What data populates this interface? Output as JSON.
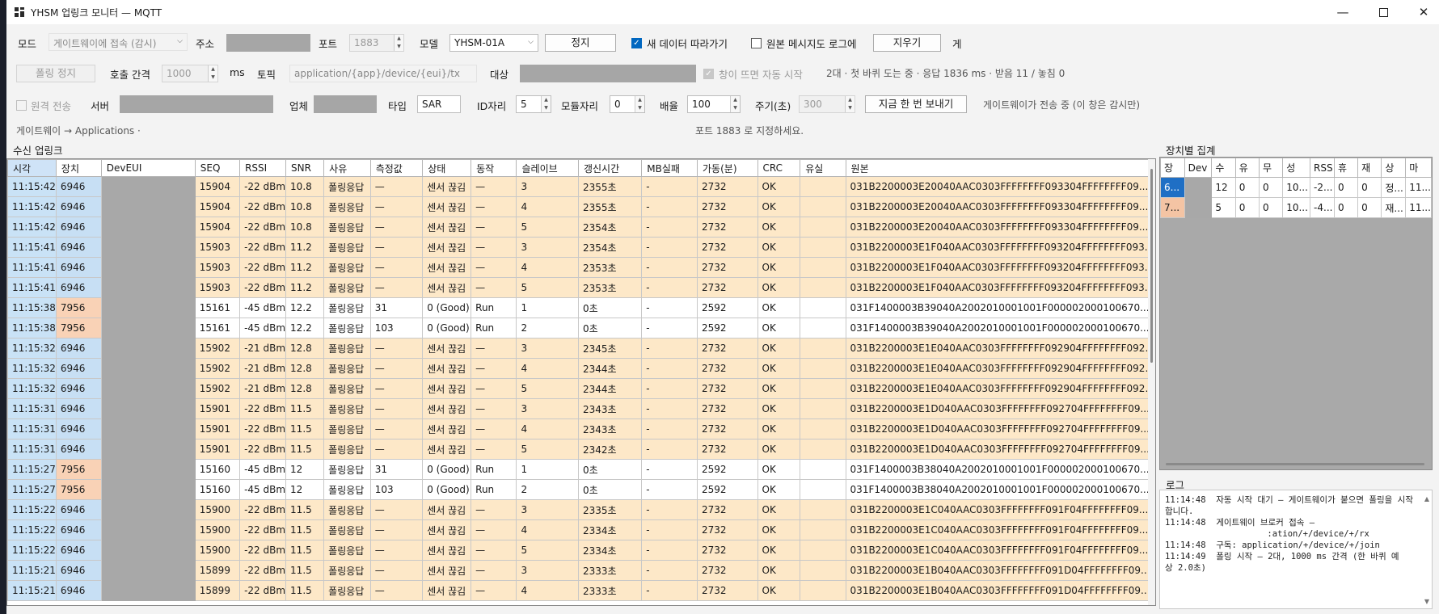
{
  "window": {
    "title": "YHSM 업링크 모니터 — MQTT"
  },
  "toolbar1": {
    "mode_label": "모드",
    "mode_value": "게이트웨이에 접속 (감시)",
    "addr_label": "주소",
    "port_label": "포트",
    "port_value": "1883",
    "model_label": "모델",
    "model_value": "YHSM-01A",
    "stop_button": "정지",
    "follow_label": "새 데이터 따라가기",
    "rawlog_label": "원본 메시지도 로그에",
    "clear_button": "지우기",
    "overflow_label": "게"
  },
  "toolbar2": {
    "poll_stop_button": "폴링 정지",
    "interval_label": "호출 간격",
    "interval_value": "1000",
    "interval_unit": "ms",
    "topic_label": "토픽",
    "topic_value": "application/{app}/device/{eui}/tx",
    "target_label": "대상",
    "autostart_label": "창이 뜨면 자동 시작",
    "status_text": "2대 · 첫 바퀴 도는 중 · 응답 1836 ms · 받음 11 / 놓침 0"
  },
  "toolbar3": {
    "remote_label": "원격 전송",
    "server_label": "서버",
    "company_label": "업체",
    "type_label": "타입",
    "type_value": "SAR",
    "id_label": "ID자리",
    "id_value": "5",
    "module_label": "모듈자리",
    "module_value": "0",
    "factor_label": "배율",
    "factor_value": "100",
    "period_label": "주기(초)",
    "period_value": "300",
    "send_now_button": "지금 한 번 보내기",
    "gw_status": "게이트웨이가 전송 중 (이 창은 감시만)"
  },
  "hints": {
    "left": "게이트웨이 → Applications ·",
    "center": "포트 1883 로 지정하세요."
  },
  "uplink": {
    "title": "수신 업링크",
    "columns": [
      "시각",
      "장치",
      "DevEUI",
      "SEQ",
      "RSSI",
      "SNR",
      "사유",
      "측정값",
      "상태",
      "동작",
      "슬레이브",
      "갱신시간",
      "MB실패",
      "가동(분)",
      "CRC",
      "유실",
      "원본"
    ],
    "rows": [
      {
        "dev": "6946",
        "cells": [
          "11:15:42",
          "6946",
          "",
          "15904",
          "-22 dBm",
          "10.8",
          "폴링응답",
          "—",
          "센서 끊김",
          "—",
          "3",
          "2355초",
          "-",
          "2732",
          "OK",
          "",
          "031B2200003E20040AAC0303FFFFFFFF093304FFFFFFFF09..."
        ]
      },
      {
        "dev": "6946",
        "cells": [
          "11:15:42",
          "6946",
          "",
          "15904",
          "-22 dBm",
          "10.8",
          "폴링응답",
          "—",
          "센서 끊김",
          "—",
          "4",
          "2355초",
          "-",
          "2732",
          "OK",
          "",
          "031B2200003E20040AAC0303FFFFFFFF093304FFFFFFFF09..."
        ]
      },
      {
        "dev": "6946",
        "cells": [
          "11:15:42",
          "6946",
          "",
          "15904",
          "-22 dBm",
          "10.8",
          "폴링응답",
          "—",
          "센서 끊김",
          "—",
          "5",
          "2354초",
          "-",
          "2732",
          "OK",
          "",
          "031B2200003E20040AAC0303FFFFFFFF093304FFFFFFFF09..."
        ]
      },
      {
        "dev": "6946",
        "cells": [
          "11:15:41",
          "6946",
          "",
          "15903",
          "-22 dBm",
          "11.2",
          "폴링응답",
          "—",
          "센서 끊김",
          "—",
          "3",
          "2354초",
          "-",
          "2732",
          "OK",
          "",
          "031B2200003E1F040AAC0303FFFFFFFF093204FFFFFFFF093..."
        ]
      },
      {
        "dev": "6946",
        "cells": [
          "11:15:41",
          "6946",
          "",
          "15903",
          "-22 dBm",
          "11.2",
          "폴링응답",
          "—",
          "센서 끊김",
          "—",
          "4",
          "2353초",
          "-",
          "2732",
          "OK",
          "",
          "031B2200003E1F040AAC0303FFFFFFFF093204FFFFFFFF093..."
        ]
      },
      {
        "dev": "6946",
        "cells": [
          "11:15:41",
          "6946",
          "",
          "15903",
          "-22 dBm",
          "11.2",
          "폴링응답",
          "—",
          "센서 끊김",
          "—",
          "5",
          "2353초",
          "-",
          "2732",
          "OK",
          "",
          "031B2200003E1F040AAC0303FFFFFFFF093204FFFFFFFF093..."
        ]
      },
      {
        "dev": "7956",
        "cells": [
          "11:15:38",
          "7956",
          "",
          "15161",
          "-45 dBm",
          "12.2",
          "폴링응답",
          "31",
          "0 (Good)",
          "Run",
          "1",
          "0초",
          "-",
          "2592",
          "OK",
          "",
          "031F1400003B39040A2002010001001F000002000100670..."
        ]
      },
      {
        "dev": "7956",
        "cells": [
          "11:15:38",
          "7956",
          "",
          "15161",
          "-45 dBm",
          "12.2",
          "폴링응답",
          "103",
          "0 (Good)",
          "Run",
          "2",
          "0초",
          "-",
          "2592",
          "OK",
          "",
          "031F1400003B39040A2002010001001F000002000100670..."
        ]
      },
      {
        "dev": "6946",
        "cells": [
          "11:15:32",
          "6946",
          "",
          "15902",
          "-21 dBm",
          "12.8",
          "폴링응답",
          "—",
          "센서 끊김",
          "—",
          "3",
          "2345초",
          "-",
          "2732",
          "OK",
          "",
          "031B2200003E1E040AAC0303FFFFFFFF092904FFFFFFFF092..."
        ]
      },
      {
        "dev": "6946",
        "cells": [
          "11:15:32",
          "6946",
          "",
          "15902",
          "-21 dBm",
          "12.8",
          "폴링응답",
          "—",
          "센서 끊김",
          "—",
          "4",
          "2344초",
          "-",
          "2732",
          "OK",
          "",
          "031B2200003E1E040AAC0303FFFFFFFF092904FFFFFFFF092..."
        ]
      },
      {
        "dev": "6946",
        "cells": [
          "11:15:32",
          "6946",
          "",
          "15902",
          "-21 dBm",
          "12.8",
          "폴링응답",
          "—",
          "센서 끊김",
          "—",
          "5",
          "2344초",
          "-",
          "2732",
          "OK",
          "",
          "031B2200003E1E040AAC0303FFFFFFFF092904FFFFFFFF092..."
        ]
      },
      {
        "dev": "6946",
        "cells": [
          "11:15:31",
          "6946",
          "",
          "15901",
          "-22 dBm",
          "11.5",
          "폴링응답",
          "—",
          "센서 끊김",
          "—",
          "3",
          "2343초",
          "-",
          "2732",
          "OK",
          "",
          "031B2200003E1D040AAC0303FFFFFFFF092704FFFFFFFF09..."
        ]
      },
      {
        "dev": "6946",
        "cells": [
          "11:15:31",
          "6946",
          "",
          "15901",
          "-22 dBm",
          "11.5",
          "폴링응답",
          "—",
          "센서 끊김",
          "—",
          "4",
          "2343초",
          "-",
          "2732",
          "OK",
          "",
          "031B2200003E1D040AAC0303FFFFFFFF092704FFFFFFFF09..."
        ]
      },
      {
        "dev": "6946",
        "cells": [
          "11:15:31",
          "6946",
          "",
          "15901",
          "-22 dBm",
          "11.5",
          "폴링응답",
          "—",
          "센서 끊김",
          "—",
          "5",
          "2342초",
          "-",
          "2732",
          "OK",
          "",
          "031B2200003E1D040AAC0303FFFFFFFF092704FFFFFFFF09..."
        ]
      },
      {
        "dev": "7956",
        "cells": [
          "11:15:27",
          "7956",
          "",
          "15160",
          "-45 dBm",
          "12",
          "폴링응답",
          "31",
          "0 (Good)",
          "Run",
          "1",
          "0초",
          "-",
          "2592",
          "OK",
          "",
          "031F1400003B38040A2002010001001F000002000100670..."
        ]
      },
      {
        "dev": "7956",
        "cells": [
          "11:15:27",
          "7956",
          "",
          "15160",
          "-45 dBm",
          "12",
          "폴링응답",
          "103",
          "0 (Good)",
          "Run",
          "2",
          "0초",
          "-",
          "2592",
          "OK",
          "",
          "031F1400003B38040A2002010001001F000002000100670..."
        ]
      },
      {
        "dev": "6946",
        "cells": [
          "11:15:22",
          "6946",
          "",
          "15900",
          "-22 dBm",
          "11.5",
          "폴링응답",
          "—",
          "센서 끊김",
          "—",
          "3",
          "2335초",
          "-",
          "2732",
          "OK",
          "",
          "031B2200003E1C040AAC0303FFFFFFFF091F04FFFFFFFF09..."
        ]
      },
      {
        "dev": "6946",
        "cells": [
          "11:15:22",
          "6946",
          "",
          "15900",
          "-22 dBm",
          "11.5",
          "폴링응답",
          "—",
          "센서 끊김",
          "—",
          "4",
          "2334초",
          "-",
          "2732",
          "OK",
          "",
          "031B2200003E1C040AAC0303FFFFFFFF091F04FFFFFFFF09..."
        ]
      },
      {
        "dev": "6946",
        "cells": [
          "11:15:22",
          "6946",
          "",
          "15900",
          "-22 dBm",
          "11.5",
          "폴링응답",
          "—",
          "센서 끊김",
          "—",
          "5",
          "2334초",
          "-",
          "2732",
          "OK",
          "",
          "031B2200003E1C040AAC0303FFFFFFFF091F04FFFFFFFF09..."
        ]
      },
      {
        "dev": "6946",
        "cells": [
          "11:15:21",
          "6946",
          "",
          "15899",
          "-22 dBm",
          "11.5",
          "폴링응답",
          "—",
          "센서 끊김",
          "—",
          "3",
          "2333초",
          "-",
          "2732",
          "OK",
          "",
          "031B2200003E1B040AAC0303FFFFFFFF091D04FFFFFFFF09..."
        ]
      },
      {
        "dev": "6946",
        "cells": [
          "11:15:21",
          "6946",
          "",
          "15899",
          "-22 dBm",
          "11.5",
          "폴링응답",
          "—",
          "센서 끊김",
          "—",
          "4",
          "2333초",
          "-",
          "2732",
          "OK",
          "",
          "031B2200003E1B040AAC0303FFFFFFFF091D04FFFFFFFF09..."
        ]
      }
    ]
  },
  "summary": {
    "title": "장치별 집계",
    "columns": [
      "장",
      "Dev",
      "수",
      "유",
      "무",
      "성",
      "RSS",
      "휴",
      "재",
      "상",
      "마"
    ],
    "rows": [
      {
        "dev": "6946",
        "cells": [
          "6...",
          "",
          "12",
          "0",
          "0",
          "10...",
          "-2...",
          "0",
          "0",
          "정...",
          "11..."
        ]
      },
      {
        "dev": "7956",
        "cells": [
          "7...",
          "",
          "5",
          "0",
          "0",
          "10...",
          "-4...",
          "0",
          "0",
          "재...",
          "11..."
        ]
      }
    ]
  },
  "log": {
    "title": "로그",
    "lines": [
      "11:14:48  자동 시작 대기 — 게이트웨이가 붙으면 폴링을 시작",
      "합니다.",
      "11:14:48  게이트웨이 브로커 접속 —",
      "                    :ation/+/device/+/rx",
      "11:14:48  구독: application/+/device/+/join",
      "11:14:49  폴링 시작 — 2대, 1000 ms 간격 (한 바퀴 예",
      "상 2.0초)"
    ]
  },
  "colors": {
    "row_6946": "#fde8c8",
    "row_7956": "#ffffff",
    "time_col": "#c9e2f6",
    "dev_6946": "#c7dff4",
    "dev_7956": "#f9d2b6",
    "accent": "#0067c0"
  }
}
